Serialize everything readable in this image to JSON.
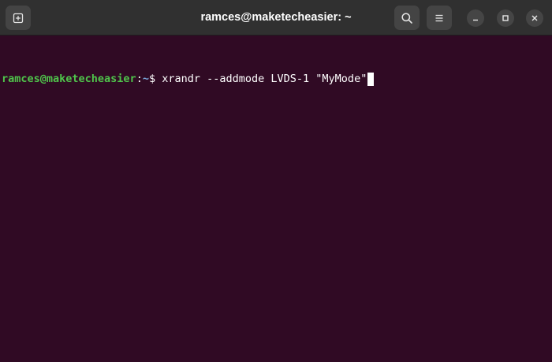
{
  "window": {
    "title": "ramces@maketecheasier: ~"
  },
  "header": {
    "new_tab_icon": "new-tab-icon",
    "search_icon": "search-icon",
    "menu_icon": "hamburger-menu-icon",
    "minimize_icon": "minimize-icon",
    "maximize_icon": "maximize-icon",
    "close_icon": "close-icon"
  },
  "terminal": {
    "prompt_user": "ramces@maketecheasier",
    "prompt_colon": ":",
    "prompt_path": "~",
    "prompt_symbol": "$ ",
    "command": "xrandr --addmode LVDS-1 \"MyMode\""
  },
  "colors": {
    "terminal_bg": "#300a24",
    "titlebar_bg": "#303030",
    "prompt_user": "#4fc44b",
    "prompt_path": "#7aa6da",
    "text": "#ffffff"
  }
}
